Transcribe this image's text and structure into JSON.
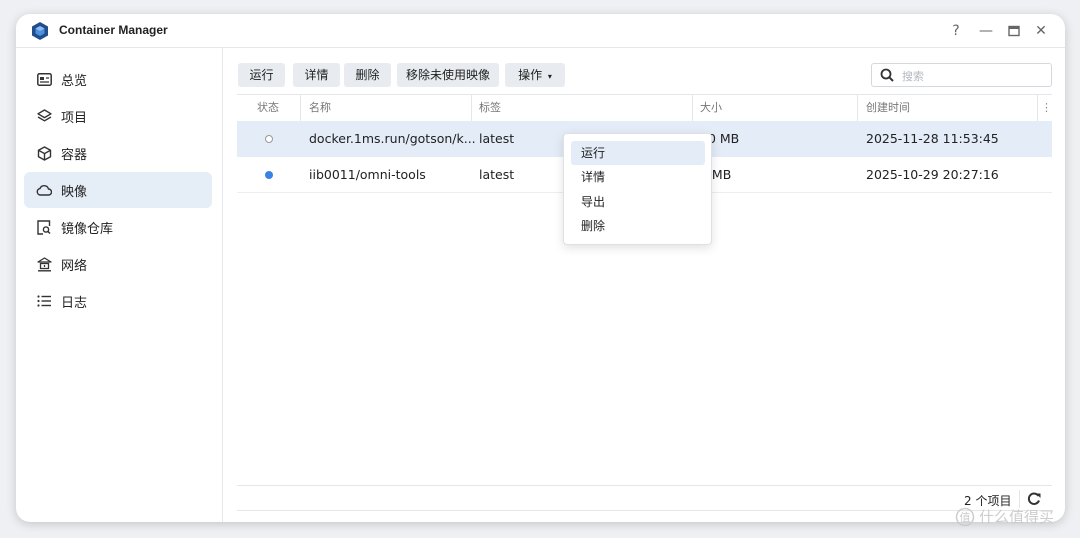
{
  "window": {
    "title": "Container Manager",
    "controls": [
      "?",
      "—",
      "▭",
      "✕"
    ]
  },
  "sidebar": {
    "items": [
      {
        "label": "总览",
        "icon": "overview-icon"
      },
      {
        "label": "项目",
        "icon": "layers-icon"
      },
      {
        "label": "容器",
        "icon": "cube-icon"
      },
      {
        "label": "映像",
        "icon": "cloud-icon",
        "active": true
      },
      {
        "label": "镜像仓库",
        "icon": "registry-search-icon"
      },
      {
        "label": "网络",
        "icon": "network-icon"
      },
      {
        "label": "日志",
        "icon": "list-icon"
      }
    ]
  },
  "toolbar": {
    "run": "运行",
    "details": "详情",
    "delete": "删除",
    "remove_unused": "移除未使用映像",
    "actions": "操作"
  },
  "search": {
    "placeholder": "搜索"
  },
  "table": {
    "headers": {
      "status": "状态",
      "name": "名称",
      "tag": "标签",
      "size": "大小",
      "created": "创建时间"
    },
    "rows": [
      {
        "status": "unused",
        "name": "docker.1ms.run/gotson/k...",
        "tag": "latest",
        "size": "70 MB",
        "created": "2025-11-28 11:53:45"
      },
      {
        "status": "in-use",
        "name": "iib0011/omni-tools",
        "tag": "latest",
        "size": "3 MB",
        "created": "2025-10-29 20:27:16"
      }
    ]
  },
  "context_menu": {
    "items": [
      "运行",
      "详情",
      "导出",
      "删除"
    ]
  },
  "footer": {
    "count": "2 个项目"
  },
  "watermark": "什么值得买",
  "colors": {
    "accent": "#3b82e6",
    "selected_row": "#e3ecf7",
    "button_bg": "#e8ecf0"
  }
}
